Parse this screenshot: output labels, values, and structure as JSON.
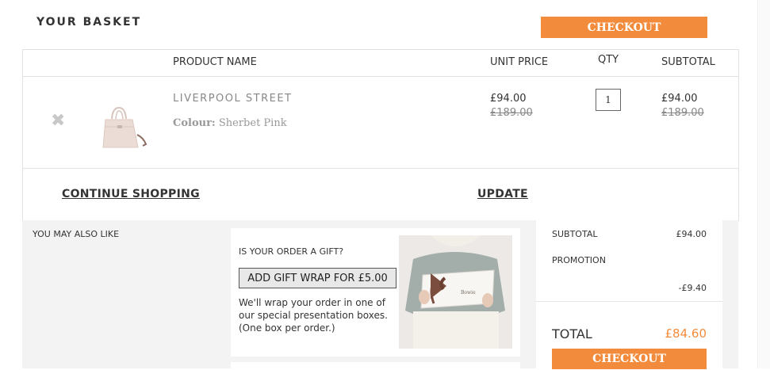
{
  "page": {
    "title": "YOUR BASKET"
  },
  "actions": {
    "checkout_label": "CHECKOUT",
    "continue_label": "CONTINUE SHOPPING",
    "update_label": "UPDATE"
  },
  "table": {
    "headers": {
      "product": "PRODUCT NAME",
      "unit_price": "UNIT PRICE",
      "qty": "QTY",
      "subtotal": "SUBTOTAL"
    },
    "items": [
      {
        "name": "LIVERPOOL STREET",
        "colour_label": "Colour:",
        "colour_value": "Sherbet Pink",
        "unit_price": "£94.00",
        "unit_price_was": "£189.00",
        "qty": "1",
        "subtotal": "£94.00",
        "subtotal_was": "£189.00",
        "remove_icon": "close-icon"
      }
    ]
  },
  "upsell": {
    "title": "YOU MAY ALSO LIKE"
  },
  "gift": {
    "question": "IS YOUR ORDER A GIFT?",
    "button_label": "ADD GIFT WRAP FOR £5.00",
    "description": "We'll wrap your order in one of our special presentation boxes. (One box per order.)"
  },
  "summary": {
    "subtotal_label": "SUBTOTAL",
    "subtotal_value": "£94.00",
    "promotion_label": "PROMOTION",
    "promotion_value": "-£9.40",
    "total_label": "TOTAL",
    "total_value": "£84.60"
  },
  "colors": {
    "accent": "#f28c3c",
    "border": "#e2e2e2",
    "panel": "#f3f3f3"
  }
}
